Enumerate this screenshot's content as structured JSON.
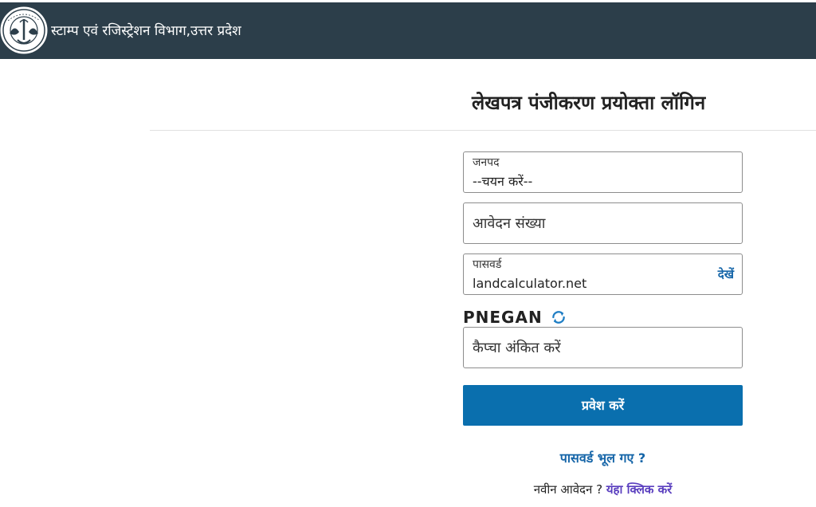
{
  "header": {
    "title": "स्टाम्प एवं रजिस्ट्रेशन विभाग,उत्तर प्रदेश",
    "logo_icon": "up-government-emblem-icon"
  },
  "page": {
    "title": "लेखपत्र पंजीकरण प्रयोक्ता लॉगिन"
  },
  "form": {
    "district": {
      "label": "जनपद",
      "value": "--चयन करें--"
    },
    "application_number": {
      "placeholder": "आवेदन संख्या"
    },
    "password": {
      "label": "पासवर्ड",
      "value": "landcalculator.net",
      "show_label": "देखें"
    },
    "captcha": {
      "code": "PNEGAN",
      "refresh_icon": "refresh-icon",
      "placeholder": "कैप्चा अंकित करें"
    },
    "login_label": "प्रवेश करें",
    "forgot_password": "पासवर्ड भूल गए ?",
    "new_application_prefix": "नवीन आवेदन ?",
    "new_application_link": "यंहा क्लिक करें"
  },
  "colors": {
    "header_bg": "#2c3e4a",
    "primary": "#0a6fae",
    "link": "#1565a8",
    "link_secondary": "#5a3fbf"
  }
}
